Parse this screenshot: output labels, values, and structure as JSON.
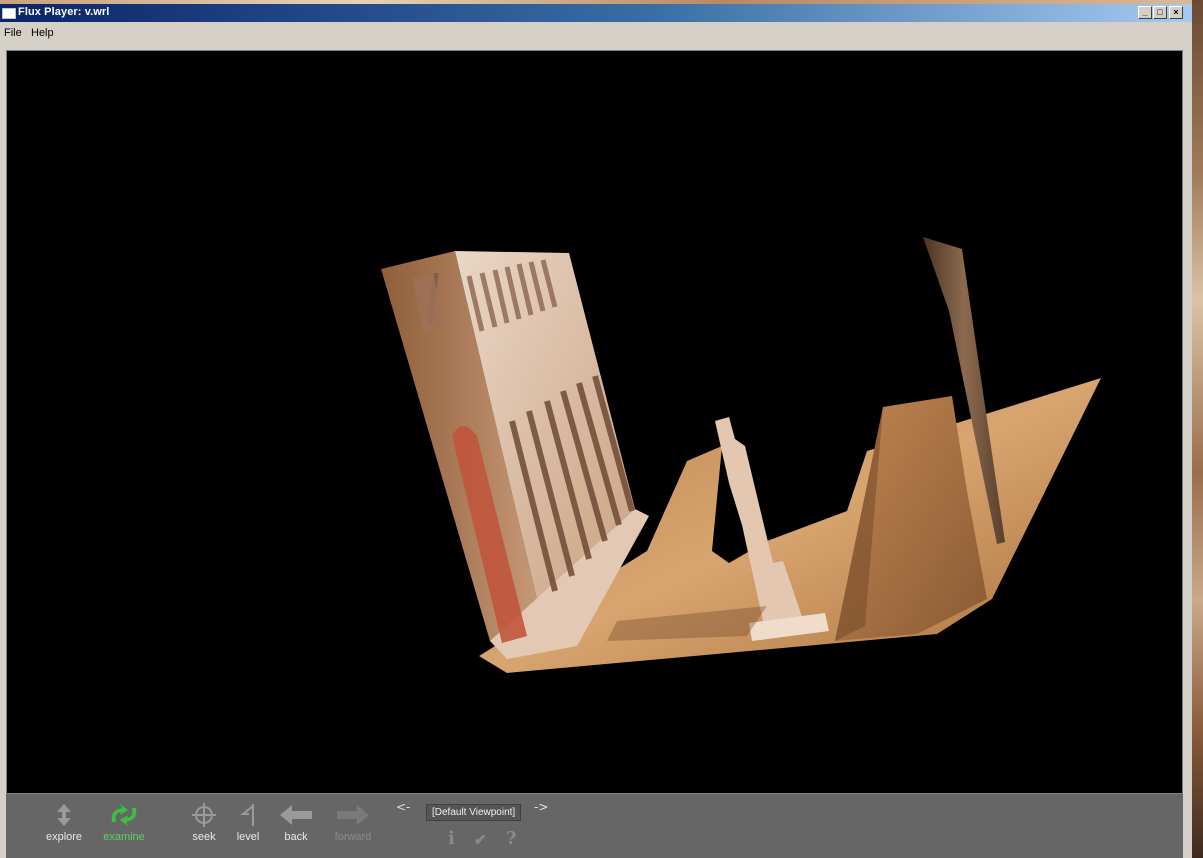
{
  "window": {
    "title": "Flux Player: v.wrl",
    "controls": {
      "minimize": "_",
      "maximize": "□",
      "close": "×"
    }
  },
  "menu": {
    "items": [
      "File",
      "Help"
    ]
  },
  "viewport": {
    "description_colors": {
      "background": "#000000",
      "sand": "#c8905a",
      "marble": "#e8cdb4"
    }
  },
  "toolbar": {
    "explore": "explore",
    "examine": "examine",
    "seek": "seek",
    "level": "level",
    "back": "back",
    "forward": "forward",
    "prev_viewpoint": "<-",
    "next_viewpoint": "->",
    "viewpoint": "[Default Viewpoint]",
    "info_icon": "i",
    "check_icon": "✔",
    "help_icon": "?",
    "active_color": "#3fbf3f"
  }
}
